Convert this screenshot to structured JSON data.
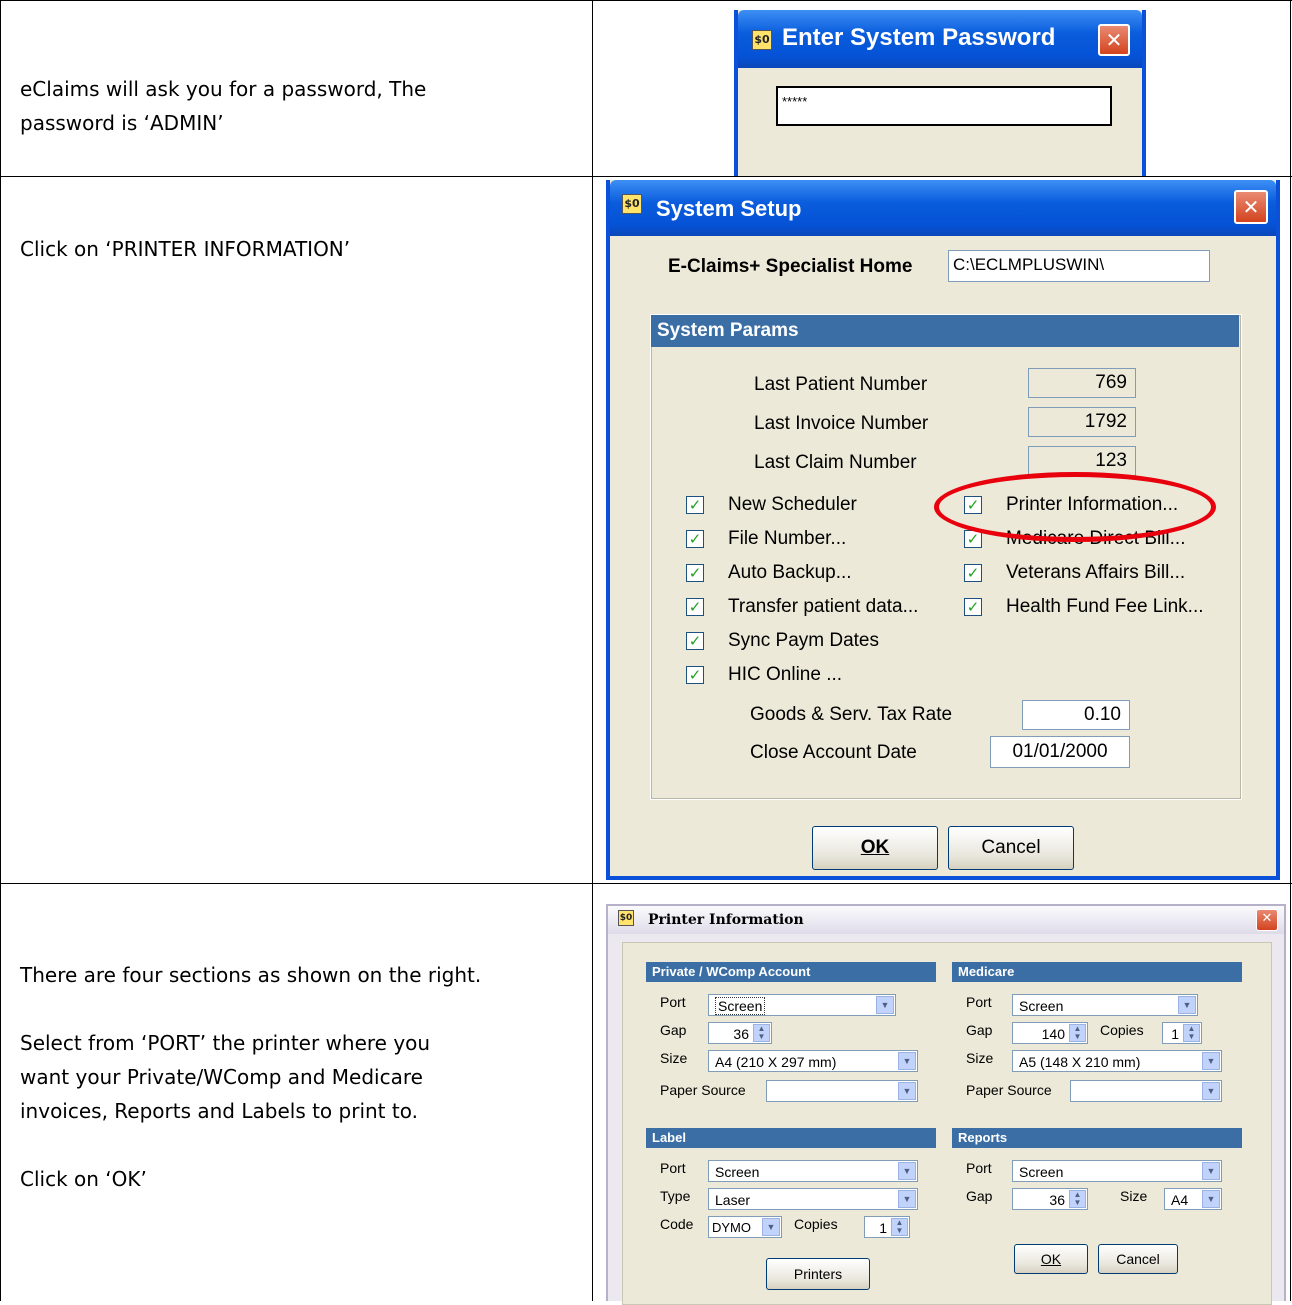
{
  "rows": [
    {
      "instruction": [
        "eClaims will ask you for a password, The",
        "password is ‘ADMIN’"
      ]
    },
    {
      "instruction": [
        "Click on ‘PRINTER INFORMATION’"
      ]
    },
    {
      "instruction": [
        "There are four sections as shown on the right.",
        "",
        "Select from ‘PORT’ the printer where you",
        "want your Private/WComp and Medicare",
        "invoices, Reports and Labels to print to.",
        "",
        "Click on ‘OK’"
      ]
    }
  ],
  "password_dialog": {
    "title": "Enter System Password",
    "app_icon": "$0",
    "close": "✕",
    "value": "*****"
  },
  "setup_dialog": {
    "title": "System Setup",
    "app_icon": "$0",
    "close": "✕",
    "home_label": "E-Claims+ Specialist Home",
    "home_value": "C:\\ECLMPLUSWIN\\",
    "params_title": "System Params",
    "last_patient_label": "Last Patient Number",
    "last_patient_value": "769",
    "last_invoice_label": "Last Invoice Number",
    "last_invoice_value": "1792",
    "last_claim_label": "Last Claim Number",
    "last_claim_value": "123",
    "checkboxes_left": [
      "New Scheduler",
      "File Number...",
      "Auto Backup...",
      "Transfer patient data...",
      "Sync Paym Dates",
      "HIC Online ..."
    ],
    "checkboxes_right": [
      "Printer Information...",
      "Medicare Direct Bill...",
      "Veterans Affairs Bill...",
      "Health Fund Fee Link..."
    ],
    "gst_label": "Goods & Serv. Tax Rate",
    "gst_value": "0.10",
    "close_date_label": "Close Account Date",
    "close_date_value": "01/01/2000",
    "ok": "OK",
    "cancel": "Cancel",
    "highlight_color": "#e8000d"
  },
  "printer_dialog": {
    "title": "Printer Information",
    "app_icon": "$0",
    "close": "✕",
    "private": {
      "title": "Private / WComp Account",
      "port_label": "Port",
      "port": "Screen",
      "gap_label": "Gap",
      "gap": "36",
      "size_label": "Size",
      "size": "A4 (210 X 297 mm)",
      "source_label": "Paper Source",
      "source": ""
    },
    "medicare": {
      "title": "Medicare",
      "port_label": "Port",
      "port": "Screen",
      "gap_label": "Gap",
      "gap": "140",
      "copies_label": "Copies",
      "copies": "1",
      "size_label": "Size",
      "size": "A5 (148 X 210 mm)",
      "source_label": "Paper Source",
      "source": ""
    },
    "label": {
      "title": "Label",
      "port_label": "Port",
      "port": "Screen",
      "type_label": "Type",
      "type": "Laser",
      "code_label": "Code",
      "code": "DYMO",
      "copies_label": "Copies",
      "copies": "1"
    },
    "reports": {
      "title": "Reports",
      "port_label": "Port",
      "port": "Screen",
      "gap_label": "Gap",
      "gap": "36",
      "size_label": "Size",
      "size": "A4"
    },
    "printers_button": "Printers",
    "ok": "OK",
    "cancel": "Cancel"
  }
}
